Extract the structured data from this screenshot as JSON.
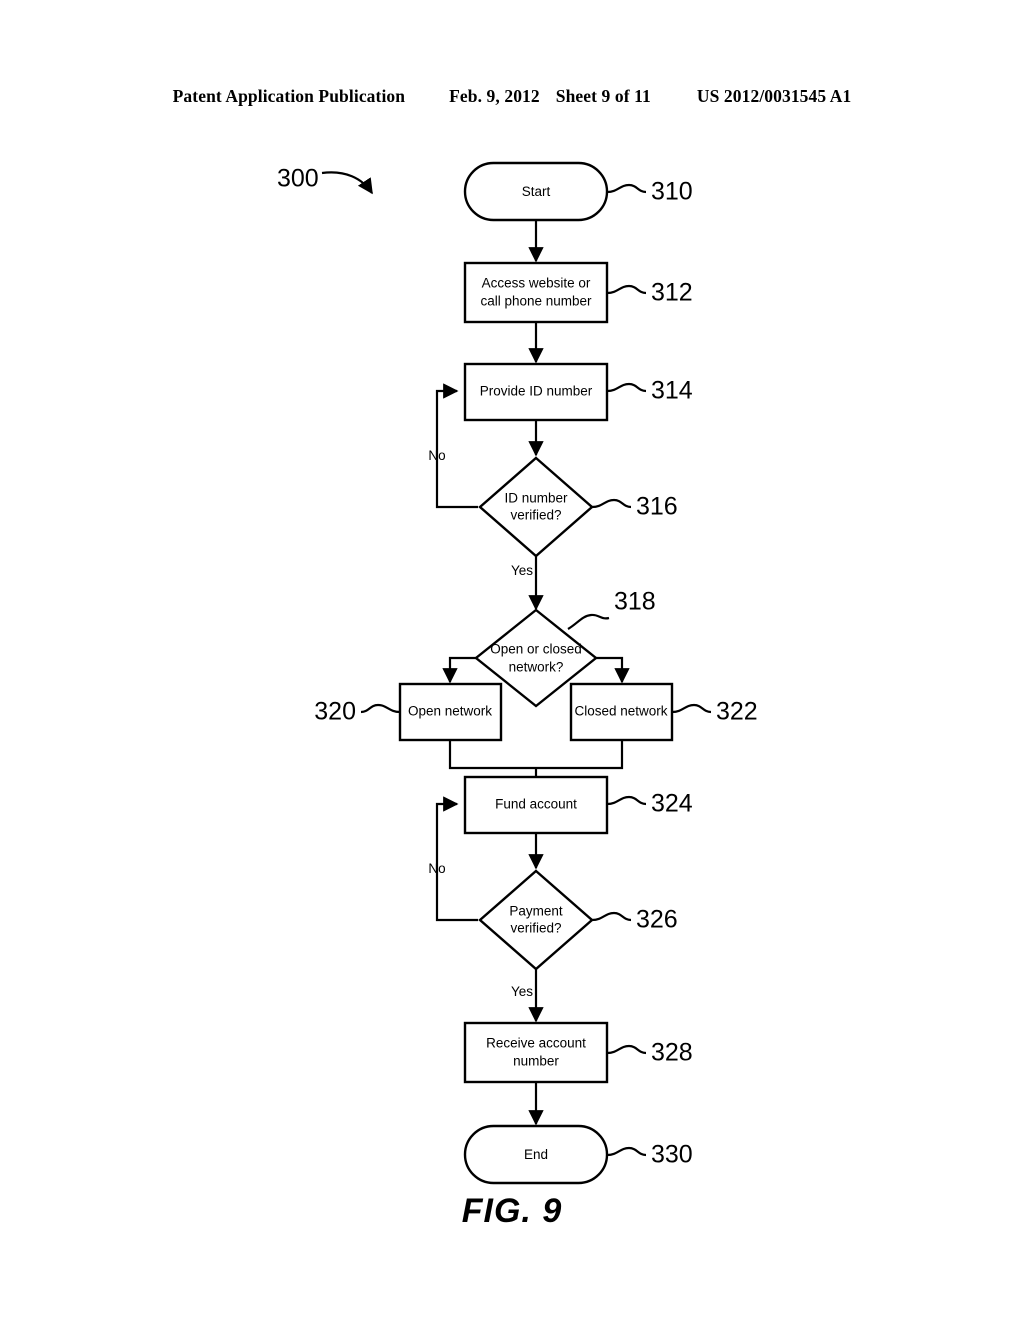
{
  "header": {
    "publication": "Patent Application Publication",
    "date": "Feb. 9, 2012",
    "sheet": "Sheet 9 of 11",
    "patent_number": "US 2012/0031545 A1"
  },
  "figure": {
    "caption": "FIG. 9",
    "diagram_label": "300"
  },
  "flowchart": {
    "type": "process-flowchart",
    "nodes": [
      {
        "ref": "310",
        "shape": "terminator",
        "label": "Start"
      },
      {
        "ref": "312",
        "shape": "process",
        "label": "Access website or call phone number",
        "line1": "Access website or",
        "line2": "call phone number"
      },
      {
        "ref": "314",
        "shape": "process",
        "label": "Provide ID number",
        "line1": "Provide ID number",
        "line2": ""
      },
      {
        "ref": "316",
        "shape": "decision",
        "label": "ID number verified?",
        "line1": "ID number",
        "line2": "verified?"
      },
      {
        "ref": "318",
        "shape": "decision",
        "label": "Open or closed network?",
        "line1": "Open or closed",
        "line2": "network?"
      },
      {
        "ref": "320",
        "shape": "process",
        "label": "Open network",
        "line1": "Open network",
        "line2": ""
      },
      {
        "ref": "322",
        "shape": "process",
        "label": "Closed network",
        "line1": "Closed network",
        "line2": ""
      },
      {
        "ref": "324",
        "shape": "process",
        "label": "Fund account",
        "line1": "Fund account",
        "line2": ""
      },
      {
        "ref": "326",
        "shape": "decision",
        "label": "Payment verified?",
        "line1": "Payment",
        "line2": "verified?"
      },
      {
        "ref": "328",
        "shape": "process",
        "label": "Receive account number",
        "line1": "Receive account",
        "line2": "number"
      },
      {
        "ref": "330",
        "shape": "terminator",
        "label": "End"
      }
    ],
    "edge_labels": {
      "id_no": "No",
      "id_yes": "Yes",
      "payment_no": "No",
      "payment_yes": "Yes"
    }
  },
  "colors": {
    "ink": "#000000",
    "paper": "#ffffff"
  }
}
